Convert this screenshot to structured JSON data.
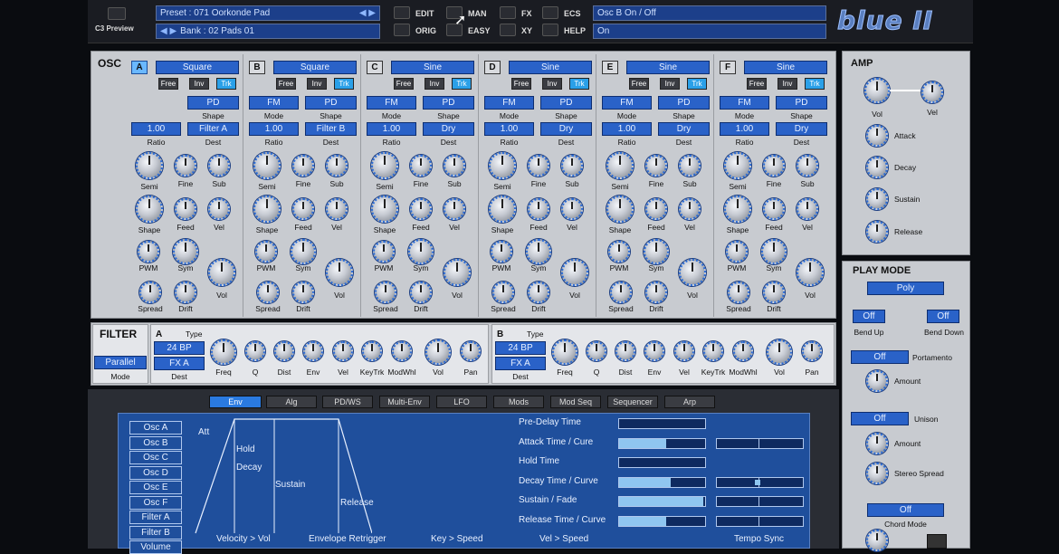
{
  "header": {
    "c3_preview": "C3 Preview",
    "preset": "Preset : 071 Oorkonde Pad",
    "bank": "Bank : 02 Pads 01",
    "modes": [
      "EDIT",
      "MAN",
      "FX",
      "ECS",
      "ORIG",
      "EASY",
      "XY",
      "HELP"
    ],
    "param_name": "Osc B On / Off",
    "param_value": "On",
    "logo": "blue II"
  },
  "osc": {
    "title": "OSC",
    "shape_label": "Shape",
    "mode_label": "Mode",
    "ratio_label": "Ratio",
    "dest_label": "Dest",
    "free": "Free",
    "inv": "Inv",
    "trk": "Trk",
    "knob_labels": [
      "Semi",
      "Fine",
      "Sub",
      "Shape",
      "Feed",
      "Vel",
      "PWM",
      "Sym",
      "Vol",
      "Spread",
      "Drift"
    ],
    "columns": [
      {
        "letter": "A",
        "wave": "Square",
        "mode": "",
        "shape": "PD",
        "ratio": "1.00",
        "dest": "Filter A",
        "active": true
      },
      {
        "letter": "B",
        "wave": "Square",
        "mode": "FM",
        "shape": "PD",
        "ratio": "1.00",
        "dest": "Filter B",
        "active": false
      },
      {
        "letter": "C",
        "wave": "Sine",
        "mode": "FM",
        "shape": "PD",
        "ratio": "1.00",
        "dest": "Dry",
        "active": false
      },
      {
        "letter": "D",
        "wave": "Sine",
        "mode": "FM",
        "shape": "PD",
        "ratio": "1.00",
        "dest": "Dry",
        "active": false
      },
      {
        "letter": "E",
        "wave": "Sine",
        "mode": "FM",
        "shape": "PD",
        "ratio": "1.00",
        "dest": "Dry",
        "active": false
      },
      {
        "letter": "F",
        "wave": "Sine",
        "mode": "FM",
        "shape": "PD",
        "ratio": "1.00",
        "dest": "Dry",
        "active": false
      }
    ]
  },
  "amp": {
    "title": "AMP",
    "knobs": [
      "Vol",
      "Vel",
      "Attack",
      "Decay",
      "Sustain",
      "Release"
    ]
  },
  "play": {
    "title": "PLAY MODE",
    "mode": "Poly",
    "off": "Off",
    "bend_up": "Bend Up",
    "bend_down": "Bend Down",
    "portamento": "Portamento",
    "amount": "Amount",
    "unison": "Unison",
    "stereo_spread": "Stereo Spread",
    "chord_mode": "Chord Mode"
  },
  "filter": {
    "title": "FILTER",
    "routing": "Parallel",
    "mode_label": "Mode",
    "type_label": "Type",
    "dest_label": "Dest",
    "a": {
      "letter": "A",
      "type": "24 BP",
      "dest": "FX A"
    },
    "b": {
      "letter": "B",
      "type": "24 BP",
      "dest": "FX A"
    },
    "knob_labels": [
      "Freq",
      "Q",
      "Dist",
      "Env",
      "Vel",
      "KeyTrk",
      "ModWhl",
      "Vol",
      "Pan"
    ]
  },
  "tabs": [
    "Env",
    "Alg",
    "PD/WS",
    "Multi-Env",
    "LFO",
    "Mods",
    "Mod Seq",
    "Sequencer",
    "Arp"
  ],
  "env": {
    "destinations": [
      "Osc A",
      "Osc B",
      "Osc C",
      "Osc D",
      "Osc E",
      "Osc F",
      "Filter A",
      "Filter B",
      "Volume"
    ],
    "stages": [
      "Att",
      "Hold",
      "Decay",
      "Sustain",
      "Release"
    ],
    "params": [
      {
        "label": "Pre-Delay Time",
        "fill": 0,
        "curve": false
      },
      {
        "label": "Attack Time / Cure",
        "fill": 0.55,
        "curve": true
      },
      {
        "label": "Hold Time",
        "fill": 0,
        "curve": false
      },
      {
        "label": "Decay Time / Curve",
        "fill": 0.6,
        "curve": true
      },
      {
        "label": "Sustain / Fade",
        "fill": 0.98,
        "curve": true
      },
      {
        "label": "Release Time / Curve",
        "fill": 0.55,
        "curve": true
      }
    ],
    "footer": [
      "Velocity > Vol",
      "Envelope Retrigger",
      "Key > Speed",
      "Vel > Speed",
      "Tempo Sync"
    ]
  }
}
